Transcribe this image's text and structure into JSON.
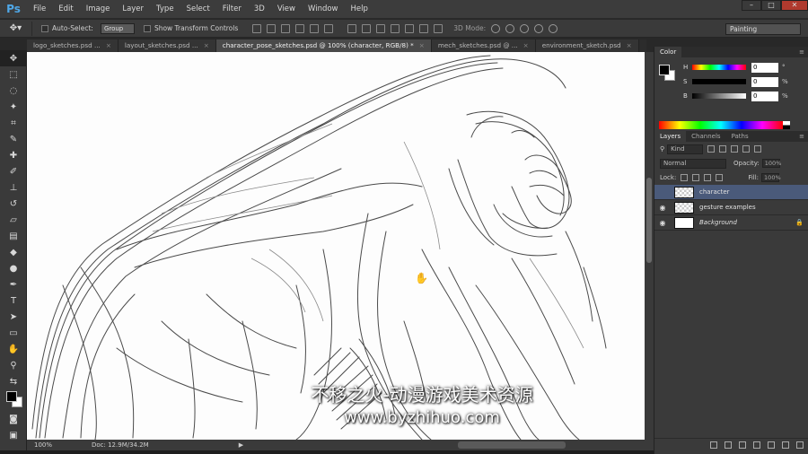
{
  "app": {
    "logo": "Ps"
  },
  "menu": [
    "File",
    "Edit",
    "Image",
    "Layer",
    "Type",
    "Select",
    "Filter",
    "3D",
    "View",
    "Window",
    "Help"
  ],
  "window_controls": {
    "minimize": "–",
    "restore": "□",
    "close": "✕"
  },
  "options": {
    "auto_select_label": "Auto-Select:",
    "auto_select_value": "Group",
    "transform_label": "Show Transform Controls",
    "mode_3d_label": "3D Mode:",
    "workspace": "Painting"
  },
  "tabs": [
    {
      "label": "logo_sketches.psd ...",
      "active": false
    },
    {
      "label": "layout_sketches.psd ...",
      "active": false
    },
    {
      "label": "character_pose_sketches.psd @ 100% (character, RGB/8) *",
      "active": true
    },
    {
      "label": "mech_sketches.psd @ ...",
      "active": false
    },
    {
      "label": "environment_sketch.psd",
      "active": false
    }
  ],
  "canvas": {
    "watermark_line1": "不移之火-动漫游戏美术资源",
    "watermark_line2": "www.byzhihuo.com"
  },
  "status": {
    "zoom": "100%",
    "doc": "Doc: 12.9M/34.2M"
  },
  "color_panel": {
    "tab": "Color",
    "rows": [
      {
        "label": "H",
        "value": "0",
        "unit": "°"
      },
      {
        "label": "S",
        "value": "0",
        "unit": "%"
      },
      {
        "label": "B",
        "value": "0",
        "unit": "%"
      }
    ],
    "foreground_color": "#000000",
    "background_color": "#ffffff"
  },
  "layers_panel": {
    "tabs": [
      "Layers",
      "Channels",
      "Paths"
    ],
    "filter_kind": "Kind",
    "blend_mode": "Normal",
    "opacity_label": "Opacity:",
    "opacity_value": "100%",
    "lock_label": "Lock:",
    "fill_label": "Fill:",
    "fill_value": "100%",
    "layers": [
      {
        "name": "character",
        "visible": false,
        "selected": true,
        "type": "transparent",
        "locked": false
      },
      {
        "name": "gesture examples",
        "visible": true,
        "selected": false,
        "type": "transparent",
        "locked": false
      },
      {
        "name": "Background",
        "visible": true,
        "selected": false,
        "type": "white",
        "locked": true
      }
    ]
  }
}
